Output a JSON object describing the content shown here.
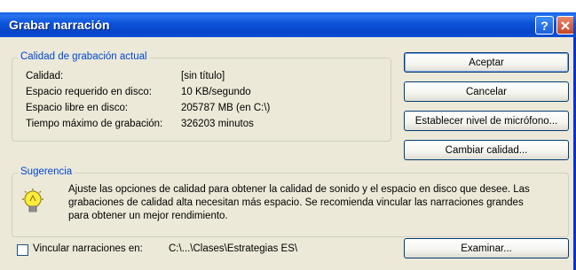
{
  "dialog": {
    "title": "Grabar narración"
  },
  "quality_group": {
    "legend": "Calidad de grabación actual",
    "rows": [
      {
        "label": "Calidad:",
        "value": "[sin título]"
      },
      {
        "label": "Espacio requerido en disco:",
        "value": "10 KB/segundo"
      },
      {
        "label": "Espacio libre en disco:",
        "value": "205787 MB (en C:\\)"
      },
      {
        "label": "Tiempo máximo de grabación:",
        "value": "326203 minutos"
      }
    ]
  },
  "buttons": {
    "accept": "Aceptar",
    "cancel": "Cancelar",
    "mic_level": "Establecer nivel de micrófono...",
    "change_quality": "Cambiar calidad...",
    "browse": "Examinar..."
  },
  "tip_group": {
    "legend": "Sugerencia",
    "text_line1": "Ajuste las opciones de calidad para obtener la calidad de sonido y el espacio en disco que desee. Las",
    "text_line2": "grabaciones de calidad alta necesitan más espacio. Se recomienda vincular las narraciones grandes",
    "text_line3": "para obtener un mejor rendimiento."
  },
  "link_option": {
    "label": "Vincular narraciones en:",
    "path": "C:\\...\\Clases\\Estrategias ES\\",
    "checked": false
  },
  "icons": {
    "help": "help-icon",
    "close": "close-icon",
    "tip": "lightbulb-icon"
  }
}
